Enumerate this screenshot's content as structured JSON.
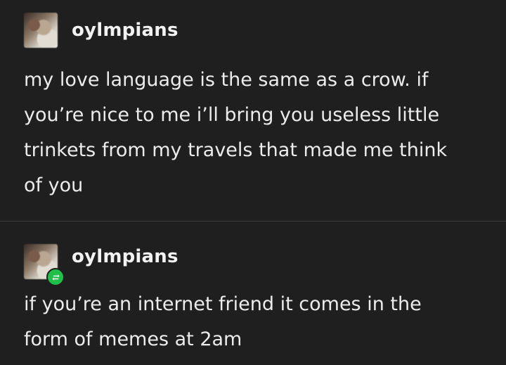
{
  "posts": [
    {
      "username": "oylmpians",
      "avatar_icon": "user-avatar-photo",
      "text": "my love language is the same as a crow. if\nyou’re nice to me i’ll bring you useless little\ntrinkets from my travels that made me think\nof you"
    },
    {
      "username": "oylmpians",
      "avatar_icon": "user-avatar-photo",
      "badge_icon": "reblog-icon",
      "badge_color": "#1fbf4a",
      "text": "if you’re an internet friend it comes in the\nform of memes at 2am"
    }
  ],
  "colors": {
    "background": "#1f1f1f",
    "text": "#ececec",
    "divider": "#3a3a3a"
  }
}
